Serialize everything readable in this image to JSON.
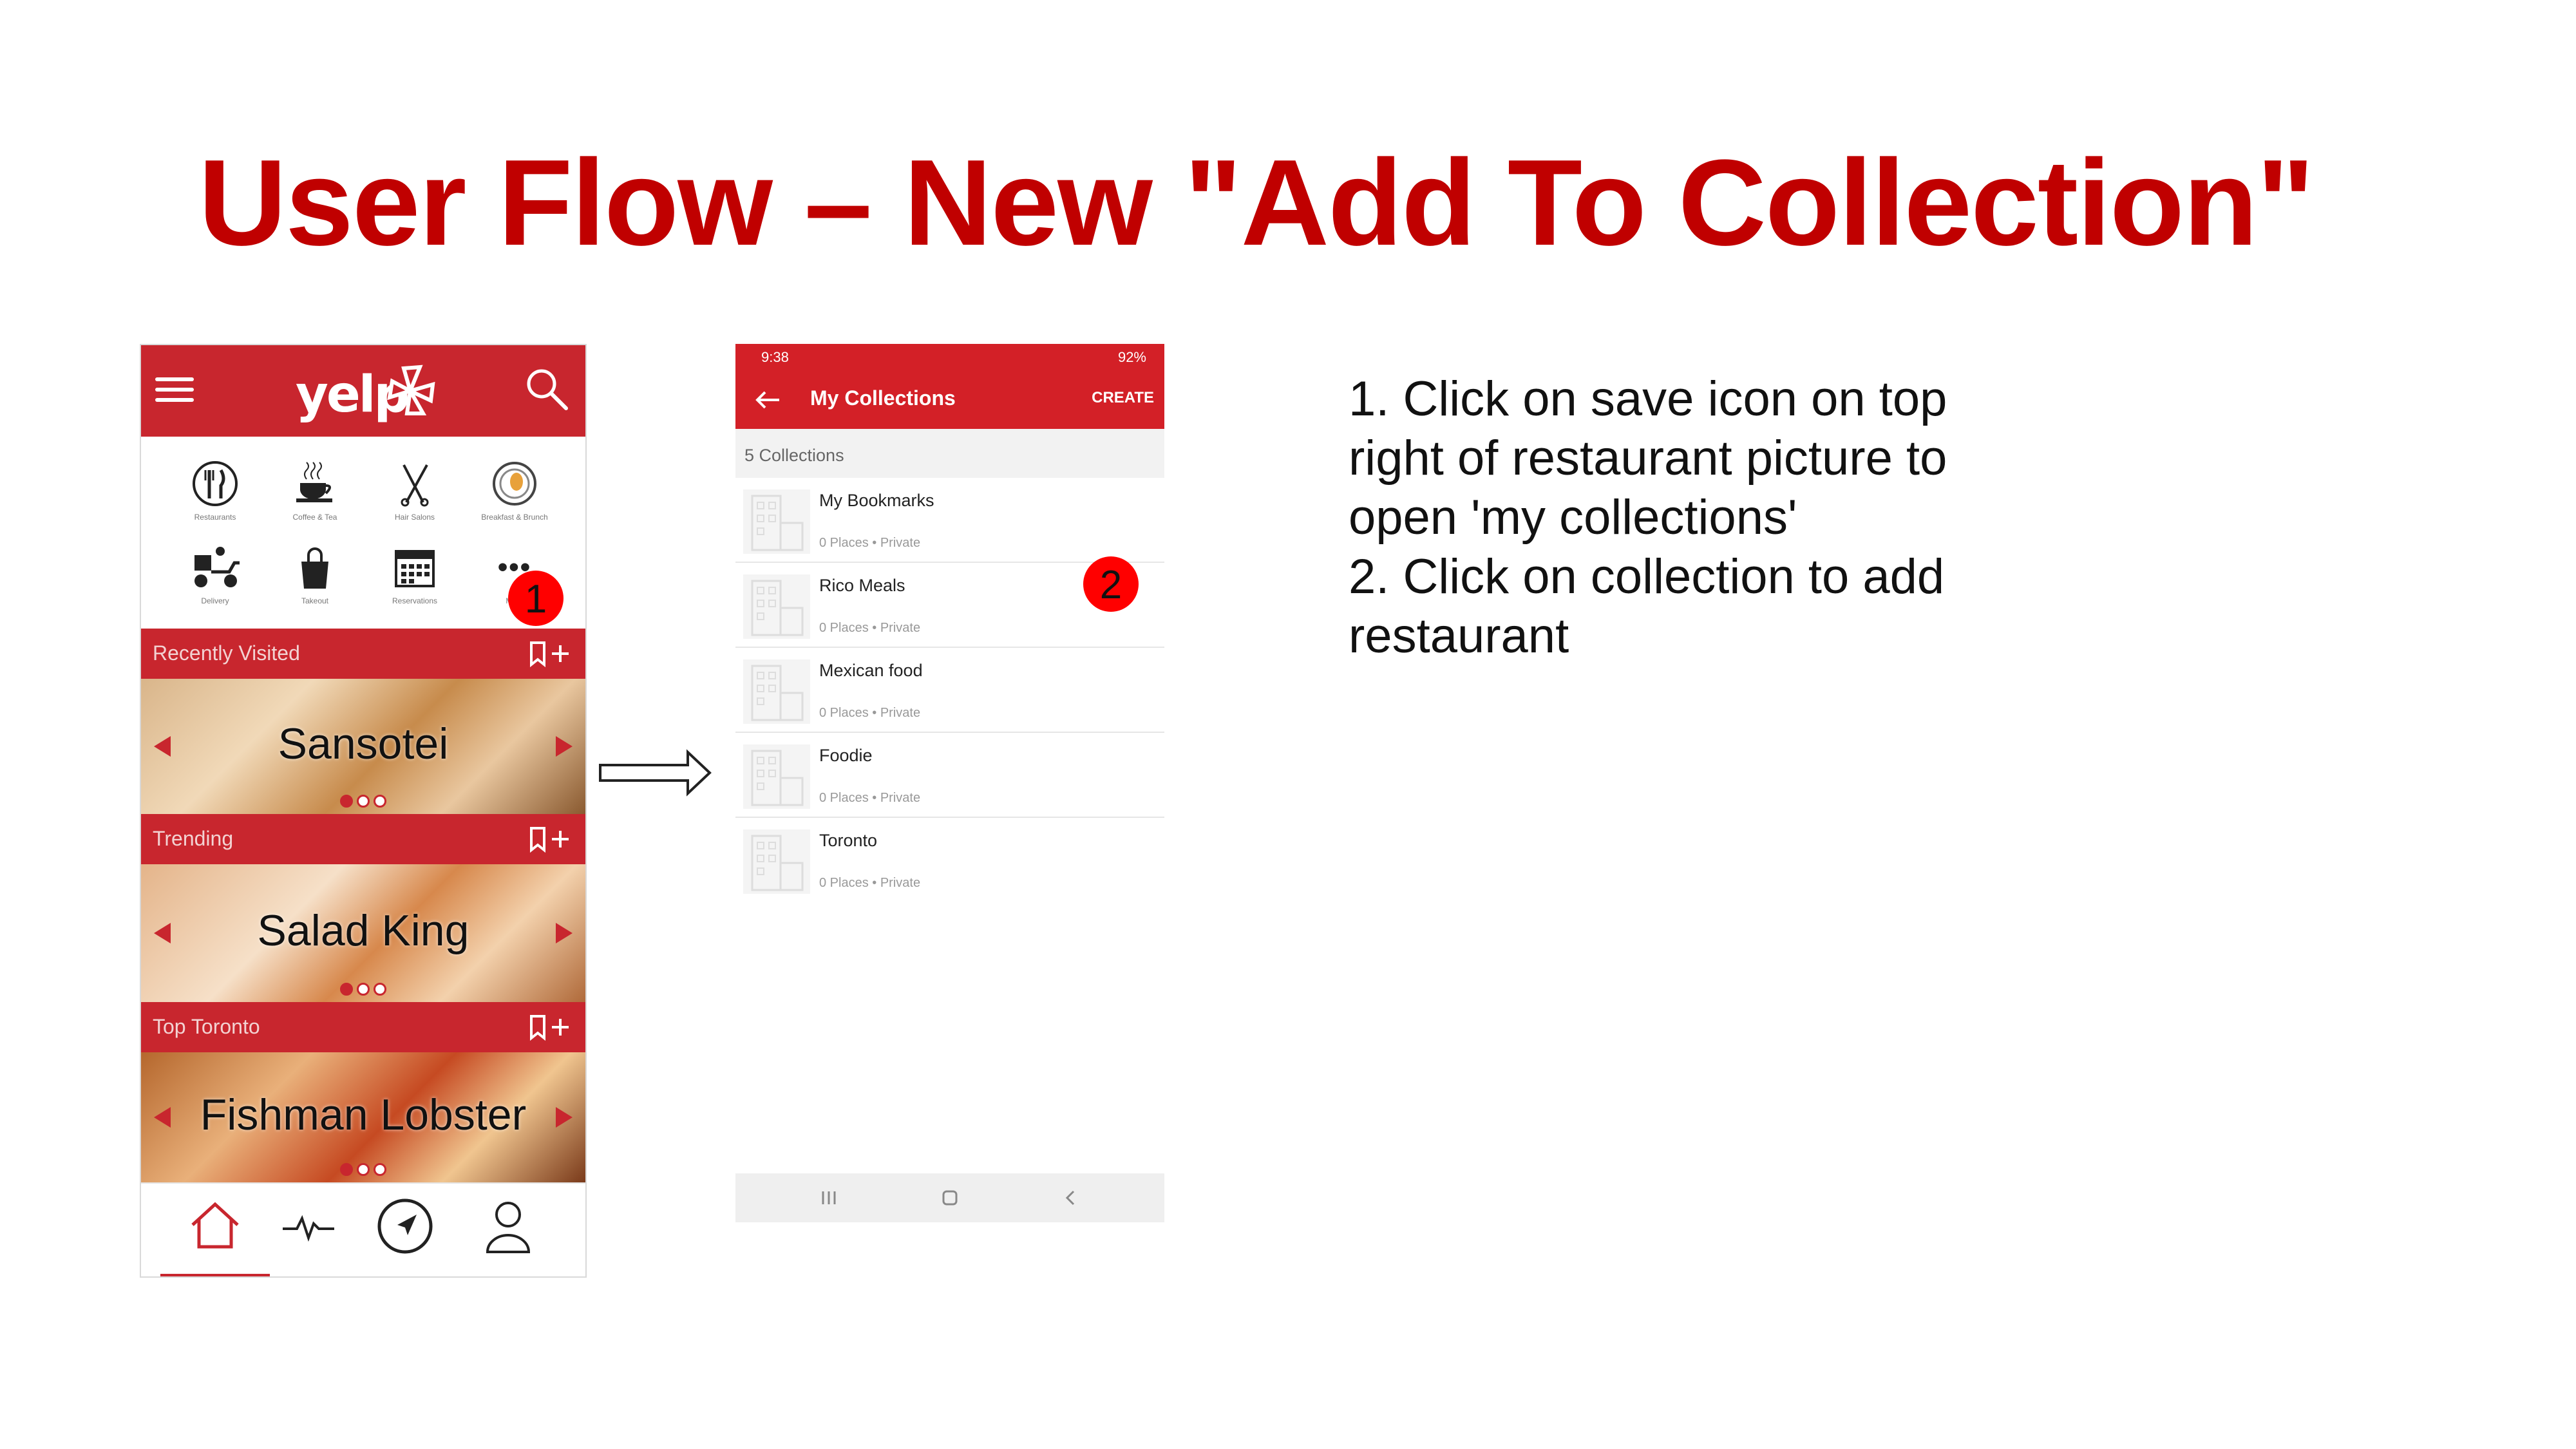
{
  "slide": {
    "title": "User Flow – New \"Add To Collection\"",
    "colors": {
      "title": "#c00000",
      "yelp_red": "#c8262e",
      "badge": "#ff0000"
    }
  },
  "phone_home": {
    "logo": "yelp",
    "categories": [
      {
        "label": "Restaurants",
        "icon": "fork-knife-icon"
      },
      {
        "label": "Coffee & Tea",
        "icon": "coffee-cup-icon"
      },
      {
        "label": "Hair Salons",
        "icon": "scissors-icon"
      },
      {
        "label": "Breakfast & Brunch",
        "icon": "breakfast-plate-icon"
      },
      {
        "label": "Delivery",
        "icon": "delivery-scooter-icon"
      },
      {
        "label": "Takeout",
        "icon": "takeout-bag-icon"
      },
      {
        "label": "Reservations",
        "icon": "calendar-icon"
      },
      {
        "label": "More",
        "icon": "more-dots-icon"
      }
    ],
    "sections": [
      {
        "title": "Recently Visited",
        "restaurant": "Sansotei"
      },
      {
        "title": "Trending",
        "restaurant": "Salad King"
      },
      {
        "title": "Top Toronto",
        "restaurant": "Fishman Lobster"
      }
    ],
    "step_badge": "1",
    "nav": [
      "home-icon",
      "activity-icon",
      "navigate-icon",
      "profile-icon"
    ]
  },
  "phone_collections": {
    "status_time": "9:38",
    "status_right": "92%",
    "header_title": "My Collections",
    "create_label": "CREATE",
    "count_label": "5 Collections",
    "collections": [
      {
        "name": "My Bookmarks",
        "meta": "0 Places • Private"
      },
      {
        "name": "Rico Meals",
        "meta": "0 Places • Private"
      },
      {
        "name": "Mexican food",
        "meta": "0 Places • Private"
      },
      {
        "name": "Foodie",
        "meta": "0 Places • Private"
      },
      {
        "name": "Toronto",
        "meta": "0 Places • Private"
      }
    ],
    "step_badge": "2"
  },
  "instructions": {
    "step1": "1. Click on save icon on top right of restaurant picture to open 'my collections'",
    "step2": "2. Click on collection to add restaurant"
  }
}
